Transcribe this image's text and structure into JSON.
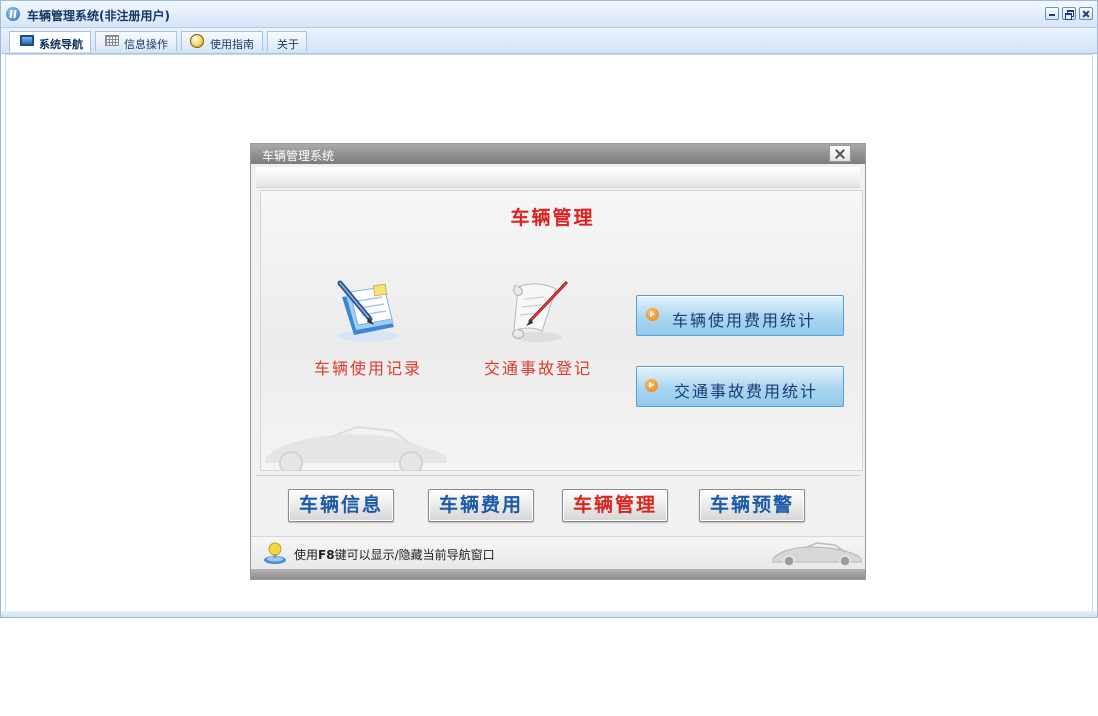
{
  "app": {
    "title": "车辆管理系统(非注册用户)"
  },
  "tabs": [
    {
      "label": "系统导航",
      "icon": "nav-icon",
      "active": true
    },
    {
      "label": "信息操作",
      "icon": "grid-icon",
      "active": false
    },
    {
      "label": "使用指南",
      "icon": "guide-icon",
      "active": false
    },
    {
      "label": "关于",
      "icon": "",
      "active": false
    }
  ],
  "dialog": {
    "title": "车辆管理系统",
    "heading": "车辆管理",
    "features": [
      {
        "label": "车辆使用记录",
        "icon": "document-pen-icon"
      },
      {
        "label": "交通事故登记",
        "icon": "scroll-quill-icon"
      }
    ],
    "stat_buttons": [
      {
        "label": "车辆使用费用统计",
        "icon": "arrow-right-icon"
      },
      {
        "label": "交通事故费用统计",
        "icon": "arrow-right-icon"
      }
    ],
    "nav_buttons": [
      {
        "label": "车辆信息",
        "current": false
      },
      {
        "label": "车辆费用",
        "current": false
      },
      {
        "label": "车辆管理",
        "current": true
      },
      {
        "label": "车辆预警",
        "current": false
      }
    ],
    "hint": {
      "prefix": "使用",
      "key": "F8",
      "suffix": "键可以显示/隐藏当前导航窗口"
    }
  },
  "colors": {
    "heading": "#de2020",
    "feature_label": "#e03a2a",
    "nav_button": "#1b5aa6",
    "nav_button_current": "#d8261e",
    "stat_button_bg": "#a9d6f1"
  }
}
